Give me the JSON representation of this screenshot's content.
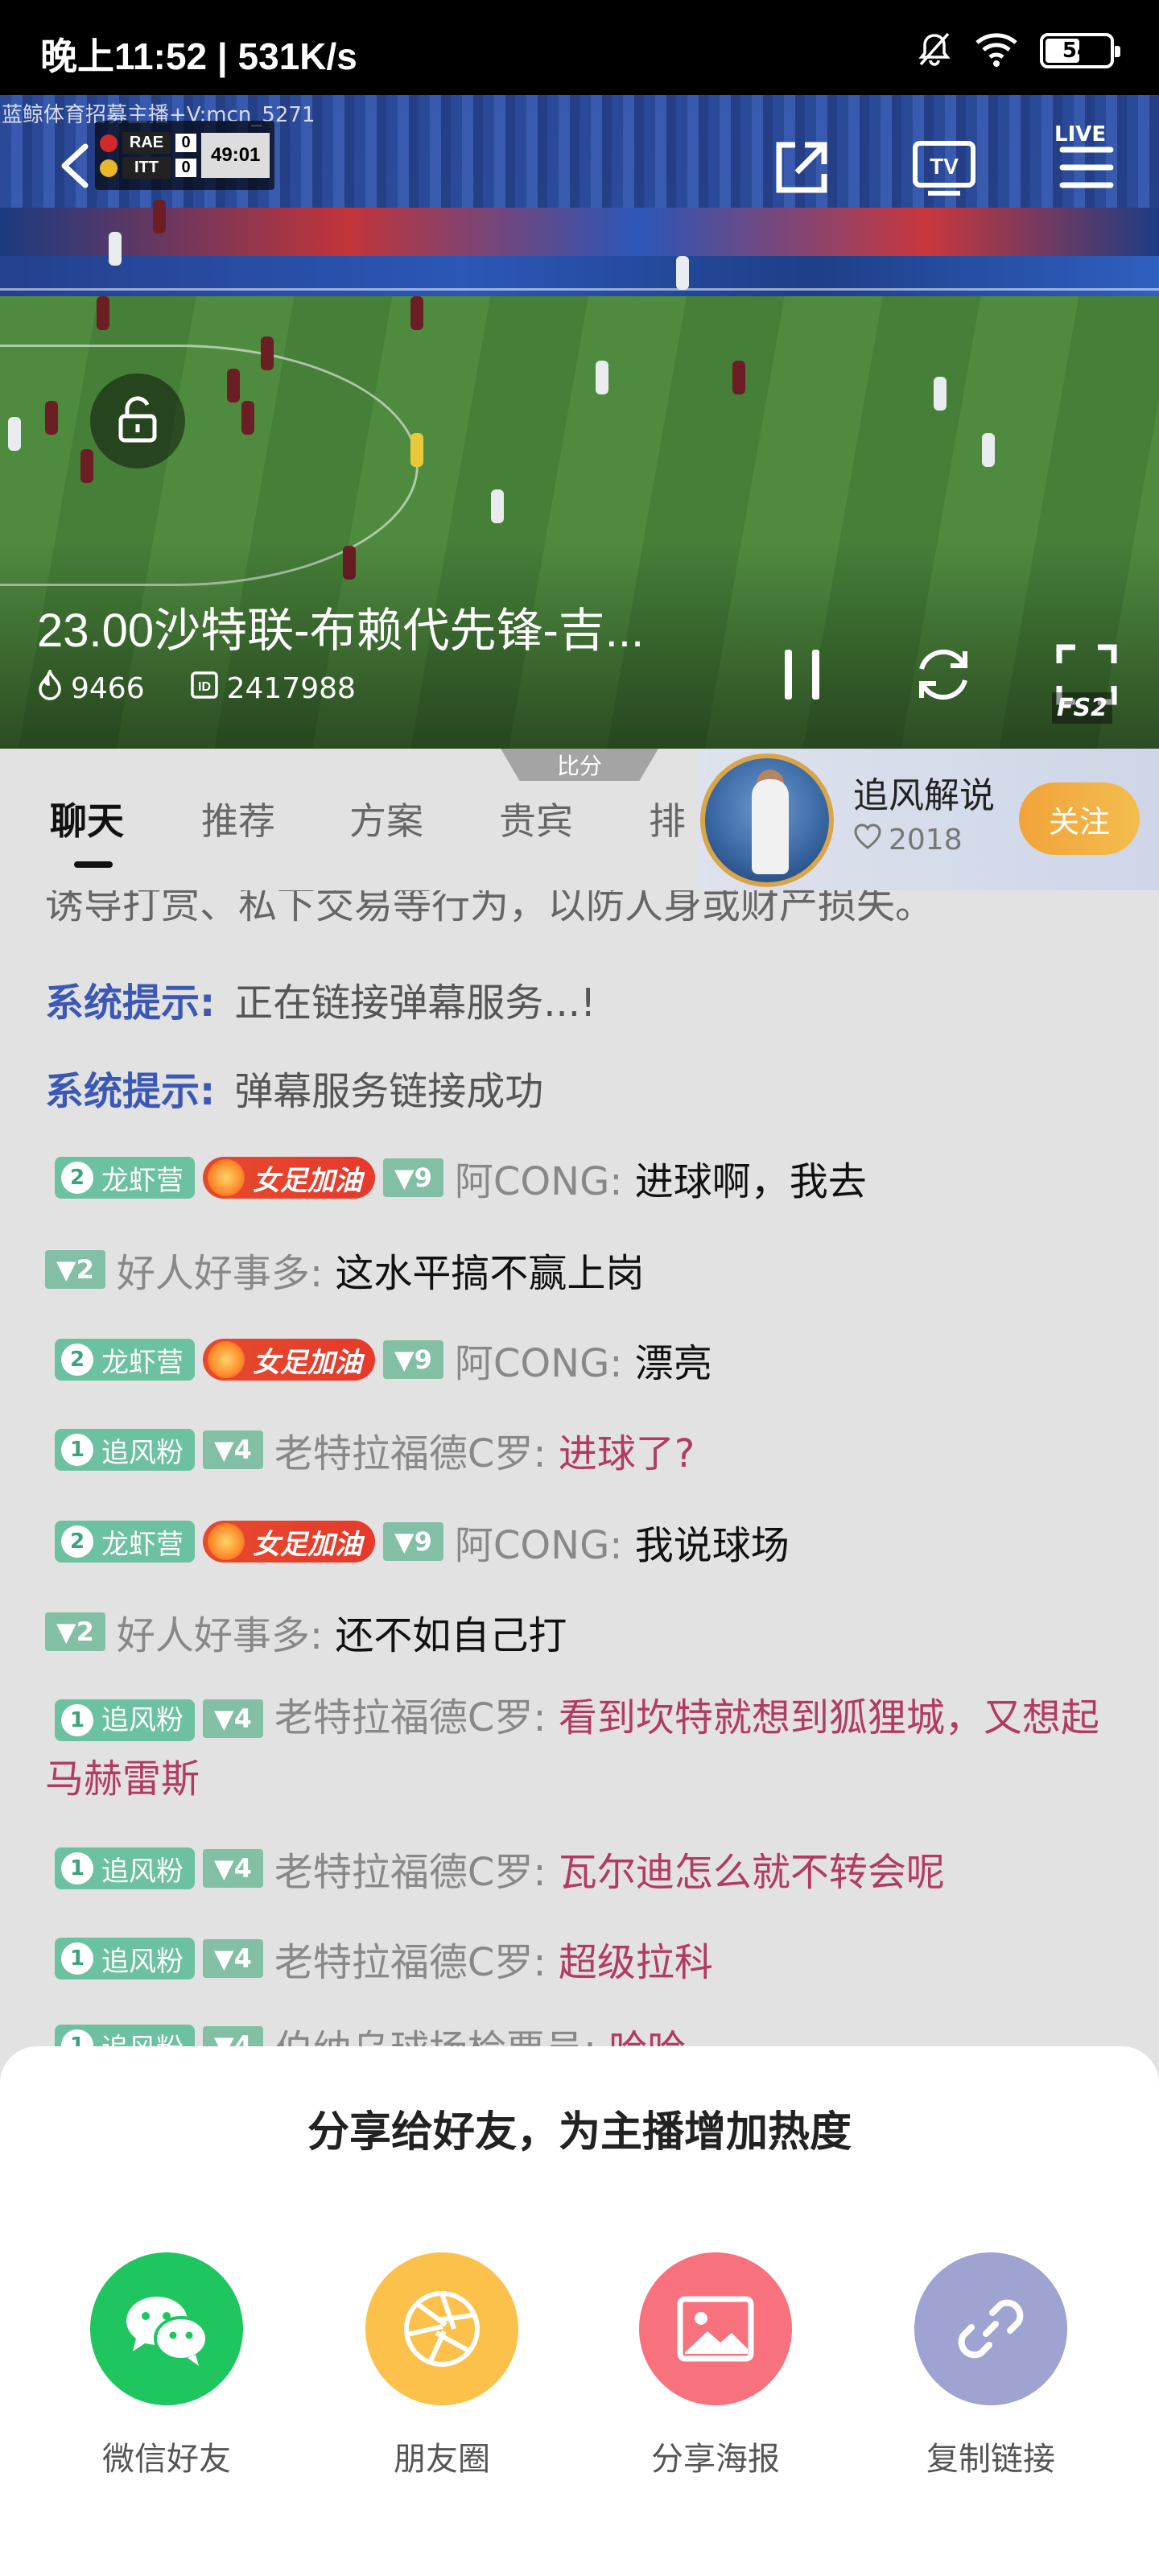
{
  "status": {
    "time_speed": "晚上11:52 | 531K/s",
    "battery": "54"
  },
  "video": {
    "watermark": "蓝鲸体育招募主播+V:mcn_5271",
    "scoreboard": {
      "home_team": "RAE",
      "home_score": "0",
      "away_team": "ITT",
      "away_score": "0",
      "clock": "49:01"
    },
    "title": "23.00沙特联-布赖代先锋-吉...",
    "heat": "9466",
    "viewers": "2417988",
    "live_badge": "LIVE",
    "channel_badge": "FS2"
  },
  "tabs": {
    "score_handle": "比分",
    "items": [
      "聊天",
      "推荐",
      "方案",
      "贵宾",
      "排"
    ]
  },
  "streamer": {
    "name": "追风解说",
    "likes": "2018",
    "follow_label": "关注"
  },
  "chat": {
    "cut_line": "诱导打赏、私下交易等行为，以防人身或财产损失。",
    "system_label": "系统提示:",
    "system_1": "正在链接弹幕服务...!",
    "system_2": "弹幕服务链接成功",
    "messages": [
      {
        "fan_level": "2",
        "fan_club": "龙虾营",
        "fire_badge": "女足加油",
        "level": "9",
        "user": "阿CONG:",
        "text": "进球啊，我去"
      },
      {
        "level": "2",
        "user": "好人好事多:",
        "text": "这水平搞不赢上岗"
      },
      {
        "fan_level": "2",
        "fan_club": "龙虾营",
        "fire_badge": "女足加油",
        "level": "9",
        "user": "阿CONG:",
        "text": "漂亮"
      },
      {
        "fan_level": "1",
        "fan_club": "追风粉",
        "level": "4",
        "user": "老特拉福德C罗:",
        "text": "进球了?"
      },
      {
        "fan_level": "2",
        "fan_club": "龙虾营",
        "fire_badge": "女足加油",
        "level": "9",
        "user": "阿CONG:",
        "text": "我说球场"
      },
      {
        "level": "2",
        "user": "好人好事多:",
        "text": "还不如自己打"
      },
      {
        "fan_level": "1",
        "fan_club": "追风粉",
        "level": "4",
        "user": "老特拉福德C罗:",
        "text": "看到坎特就想到狐狸城，又想起马赫雷斯"
      },
      {
        "fan_level": "1",
        "fan_club": "追风粉",
        "level": "4",
        "user": "老特拉福德C罗:",
        "text": "瓦尔迪怎么就不转会呢"
      },
      {
        "fan_level": "1",
        "fan_club": "追风粉",
        "level": "4",
        "user": "老特拉福德C罗:",
        "text": "超级拉科"
      },
      {
        "fan_level": "1",
        "fan_club": "追风粉",
        "level": "4",
        "user": "伯纳乌球场检票员:",
        "text": "哈哈"
      }
    ]
  },
  "share": {
    "title": "分享给好友，为主播增加热度",
    "items": [
      {
        "label": "微信好友",
        "icon": "wechat-icon",
        "color": "#1fc65f"
      },
      {
        "label": "朋友圈",
        "icon": "moments-icon",
        "color": "#fcc14a"
      },
      {
        "label": "分享海报",
        "icon": "image-icon",
        "color": "#f8727d"
      },
      {
        "label": "复制链接",
        "icon": "link-icon",
        "color": "#9ea3d2"
      }
    ]
  }
}
